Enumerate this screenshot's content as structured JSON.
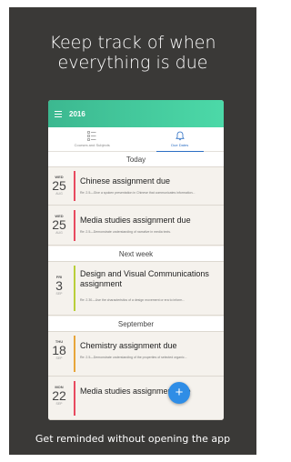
{
  "promo": {
    "headline_line1": "Keep track of when",
    "headline_line2": "everything is due",
    "footer": "Get reminded without opening the app"
  },
  "appbar": {
    "year": "2016"
  },
  "tabs": [
    {
      "label": "Courses and Subjects",
      "icon": "list-icon"
    },
    {
      "label": "Due Dates",
      "icon": "bell-icon"
    }
  ],
  "sections": {
    "today": "Today",
    "next_week": "Next week",
    "september": "September"
  },
  "cards": [
    {
      "dow": "WED",
      "day": "25",
      "mon": "AUG",
      "title": "Chinese assignment due",
      "desc": "Re: 2.5—Give a spoken presentation in Chinese that communicates information...",
      "accent": "#e84a5f"
    },
    {
      "dow": "WED",
      "day": "25",
      "mon": "AUG",
      "title": "Media studies assignment due",
      "desc": "Re: 2.5—Demonstrate understanding of narrative in media texts.",
      "accent": "#e84a5f"
    },
    {
      "dow": "FRI",
      "day": "3",
      "mon": "SEP",
      "title": "Design and Visual Communications assignment",
      "desc": "Re: 2.30—Use the characteristics of a design movement or era to inform...",
      "accent": "#b9cf3a"
    },
    {
      "dow": "THU",
      "day": "18",
      "mon": "SEP",
      "title": "Chemistry assignment due",
      "desc": "Re: 2.5—Demonstrate understanding of the properties of selected organic...",
      "accent": "#e8a53a"
    },
    {
      "dow": "MON",
      "day": "22",
      "mon": "SEP",
      "title": "Media studies assignment due",
      "desc": "",
      "accent": "#e84a5f"
    }
  ],
  "fab": {
    "label": "+"
  }
}
